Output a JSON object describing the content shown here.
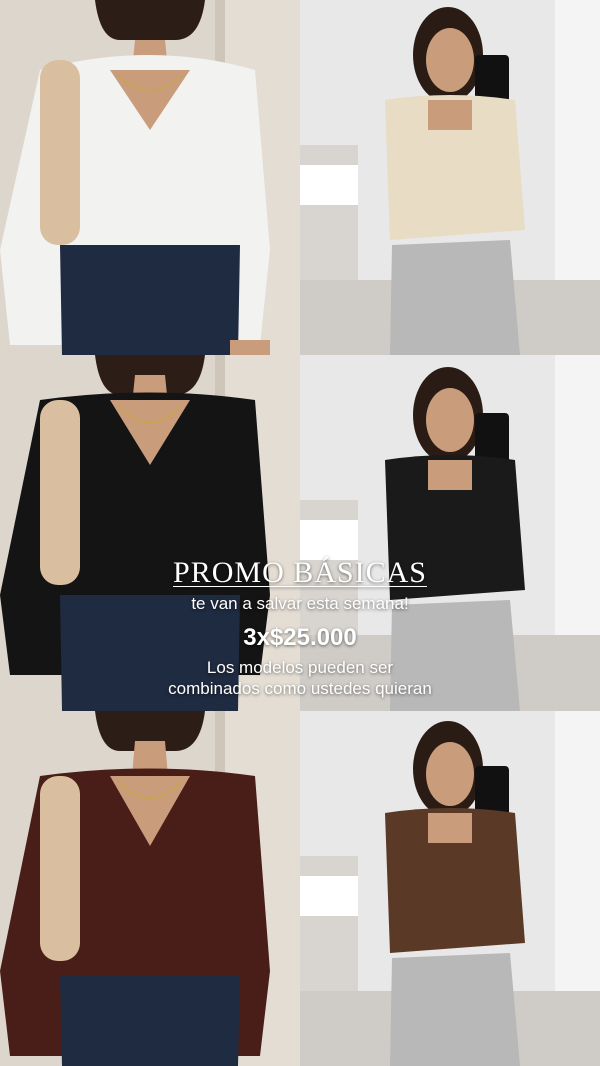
{
  "promo": {
    "title": "PROMO BÁSICAS",
    "subtitle": "te van a salvar esta semana!",
    "price": "3x$25.000",
    "note_line1": "Los modelos pueden ser",
    "note_line2": "combinados como ustedes quieran"
  },
  "tops": [
    {
      "style": "v-neck",
      "color": "#f2f2f1",
      "bottom": "jeans"
    },
    {
      "style": "square-neck",
      "color": "#e8dcc4",
      "bottom": "grey-sweatpants"
    },
    {
      "style": "v-neck",
      "color": "#141414",
      "bottom": "jeans"
    },
    {
      "style": "square-neck",
      "color": "#1a1a1a",
      "bottom": "grey-sweatpants"
    },
    {
      "style": "v-neck",
      "color": "#4a1e18",
      "bottom": "jeans"
    },
    {
      "style": "square-neck",
      "color": "#5a3a26",
      "bottom": "grey-sweatpants"
    }
  ]
}
